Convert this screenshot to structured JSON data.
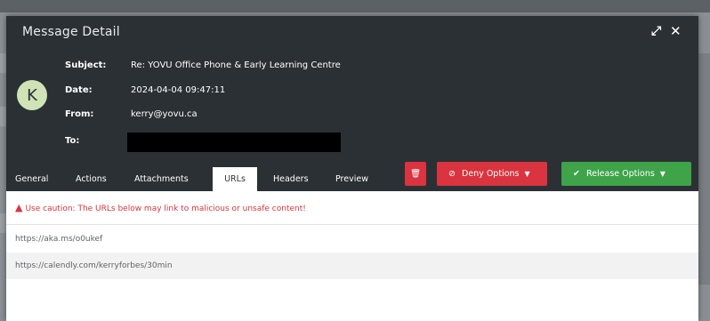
{
  "modal": {
    "title": "Message Detail",
    "expand_icon": "expand-arrows-icon",
    "close_icon": "close-icon"
  },
  "avatar": {
    "initial": "K"
  },
  "message": {
    "subject_label": "Subject:",
    "subject": "Re: YOVU Office Phone & Early Learning Centre",
    "date_label": "Date:",
    "date": "2024-04-04 09:47:11",
    "from_label": "From:",
    "from": "kerry@yovu.ca",
    "to_label": "To:",
    "to": ""
  },
  "tabs": [
    {
      "label": "General"
    },
    {
      "label": "Actions"
    },
    {
      "label": "Attachments"
    },
    {
      "label": "URLs"
    },
    {
      "label": "Headers"
    },
    {
      "label": "Preview"
    }
  ],
  "active_tab": "URLs",
  "actions": {
    "delete_icon": "trash-icon",
    "deny_label": "Deny Options",
    "deny_icon": "ban-icon",
    "release_label": "Release Options",
    "release_icon": "check-icon"
  },
  "warning": {
    "icon": "warning-triangle-icon",
    "text": "Use caution: The URLs below may link to malicious or unsafe content!"
  },
  "urls": [
    "https://aka.ms/o0ukef",
    "https://calendly.com/kerryforbes/30min"
  ],
  "colors": {
    "header_bg": "#2b3035",
    "danger": "#d9343f",
    "success": "#3fa34a",
    "avatar_bg": "#cfe3b6"
  }
}
